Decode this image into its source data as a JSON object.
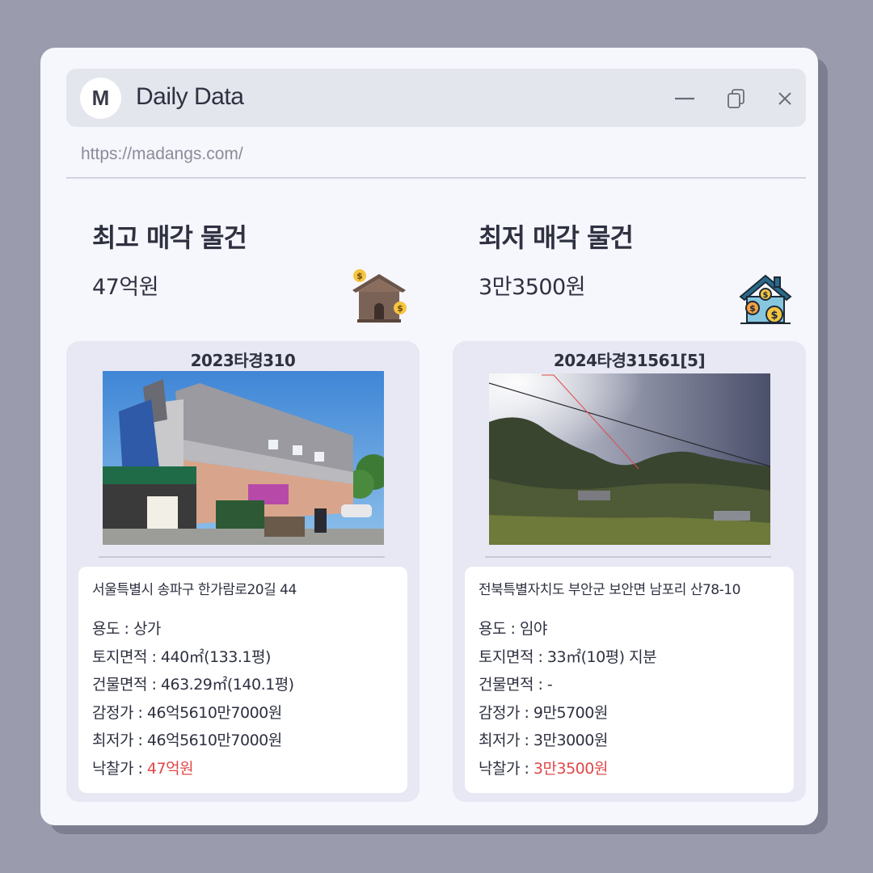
{
  "app": {
    "logo_letter": "M",
    "title": "Daily Data",
    "url": "https://madangs.com/"
  },
  "window_controls": [
    "minimize-icon",
    "copy-icon",
    "close-icon"
  ],
  "colors": {
    "background": "#9a9cad",
    "window": "#f6f6fd",
    "titlebar": "#e4e6ee",
    "card": "#e7e8f3",
    "highlight_price": "#e04848"
  },
  "highest": {
    "heading": "최고 매각 물건",
    "amount": "47억원",
    "icon": "house-money-icon",
    "case_no": "2023타경310",
    "photo": "commercial-building-photo",
    "address": "서울특별시 송파구 한가람로20길 44",
    "usage_label": "용도 : ",
    "usage": "상가",
    "land_area_label": "토지면적 : ",
    "land_area": "440㎡(133.1평)",
    "building_area_label": "건물면적 : ",
    "building_area": "463.29㎡(140.1평)",
    "appraisal_label": "감정가 : ",
    "appraisal": "46억5610만7000원",
    "minimum_label": "최저가 : ",
    "minimum": "46억5610만7000원",
    "winning_bid_label": "낙찰가 : ",
    "winning_bid": "47억원"
  },
  "lowest": {
    "heading": "최저 매각 물건",
    "amount": "3만3500원",
    "icon": "house-coins-icon",
    "case_no": "2024타경31561[5]",
    "photo": "forest-hill-photo",
    "address": "전북특별자치도 부안군 보안면 남포리 산78-10",
    "usage_label": "용도 : ",
    "usage": "임야",
    "land_area_label": "토지면적 : ",
    "land_area": "33㎡(10평) 지분",
    "building_area_label": "건물면적 : ",
    "building_area": "-",
    "appraisal_label": "감정가 : ",
    "appraisal": "9만5700원",
    "minimum_label": "최저가 : ",
    "minimum": "3만3000원",
    "winning_bid_label": "낙찰가 : ",
    "winning_bid": "3만3500원"
  }
}
